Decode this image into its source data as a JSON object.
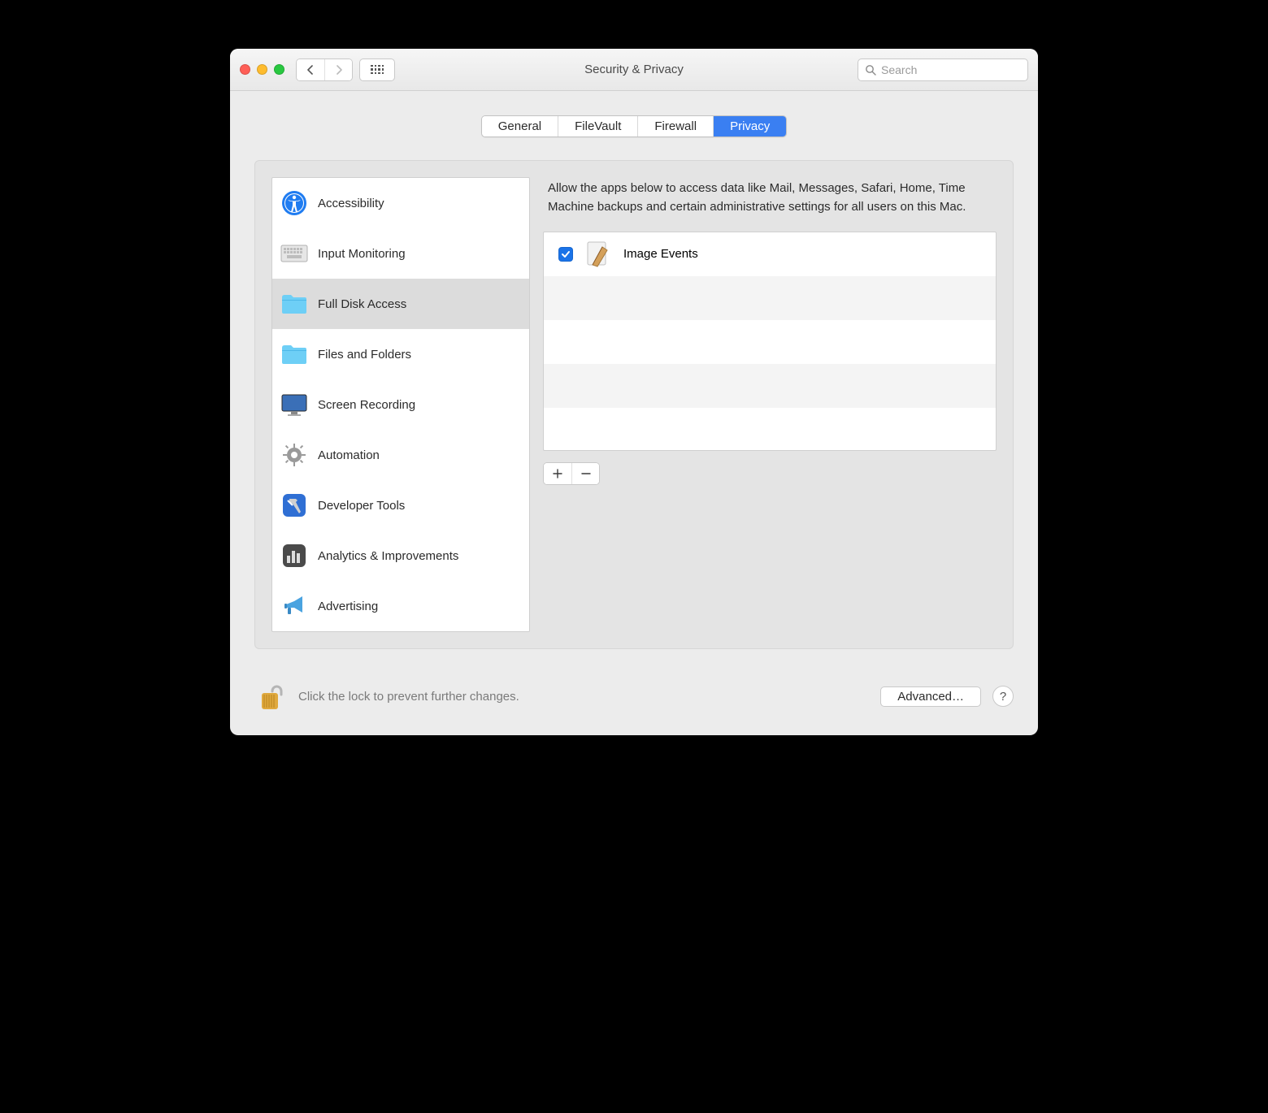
{
  "header": {
    "title": "Security & Privacy",
    "search_placeholder": "Search"
  },
  "tabs": [
    {
      "label": "General",
      "selected": false
    },
    {
      "label": "FileVault",
      "selected": false
    },
    {
      "label": "Firewall",
      "selected": false
    },
    {
      "label": "Privacy",
      "selected": true
    }
  ],
  "sidebar": {
    "items": [
      {
        "label": "Accessibility",
        "icon": "accessibility-icon",
        "selected": false
      },
      {
        "label": "Input Monitoring",
        "icon": "keyboard-icon",
        "selected": false
      },
      {
        "label": "Full Disk Access",
        "icon": "folder-icon",
        "selected": true
      },
      {
        "label": "Files and Folders",
        "icon": "folder-icon",
        "selected": false
      },
      {
        "label": "Screen Recording",
        "icon": "display-icon",
        "selected": false
      },
      {
        "label": "Automation",
        "icon": "gear-icon",
        "selected": false
      },
      {
        "label": "Developer Tools",
        "icon": "hammer-icon",
        "selected": false
      },
      {
        "label": "Analytics & Improvements",
        "icon": "bars-icon",
        "selected": false
      },
      {
        "label": "Advertising",
        "icon": "megaphone-icon",
        "selected": false
      }
    ]
  },
  "detail": {
    "description": "Allow the apps below to access data like Mail, Messages, Safari, Home, Time Machine backups and certain administrative settings for all users on this Mac.",
    "apps": [
      {
        "name": "Image Events",
        "checked": true,
        "icon": "script-app-icon"
      }
    ]
  },
  "footer": {
    "lock_hint": "Click the lock to prevent further changes.",
    "advanced_label": "Advanced…",
    "help_label": "?"
  }
}
